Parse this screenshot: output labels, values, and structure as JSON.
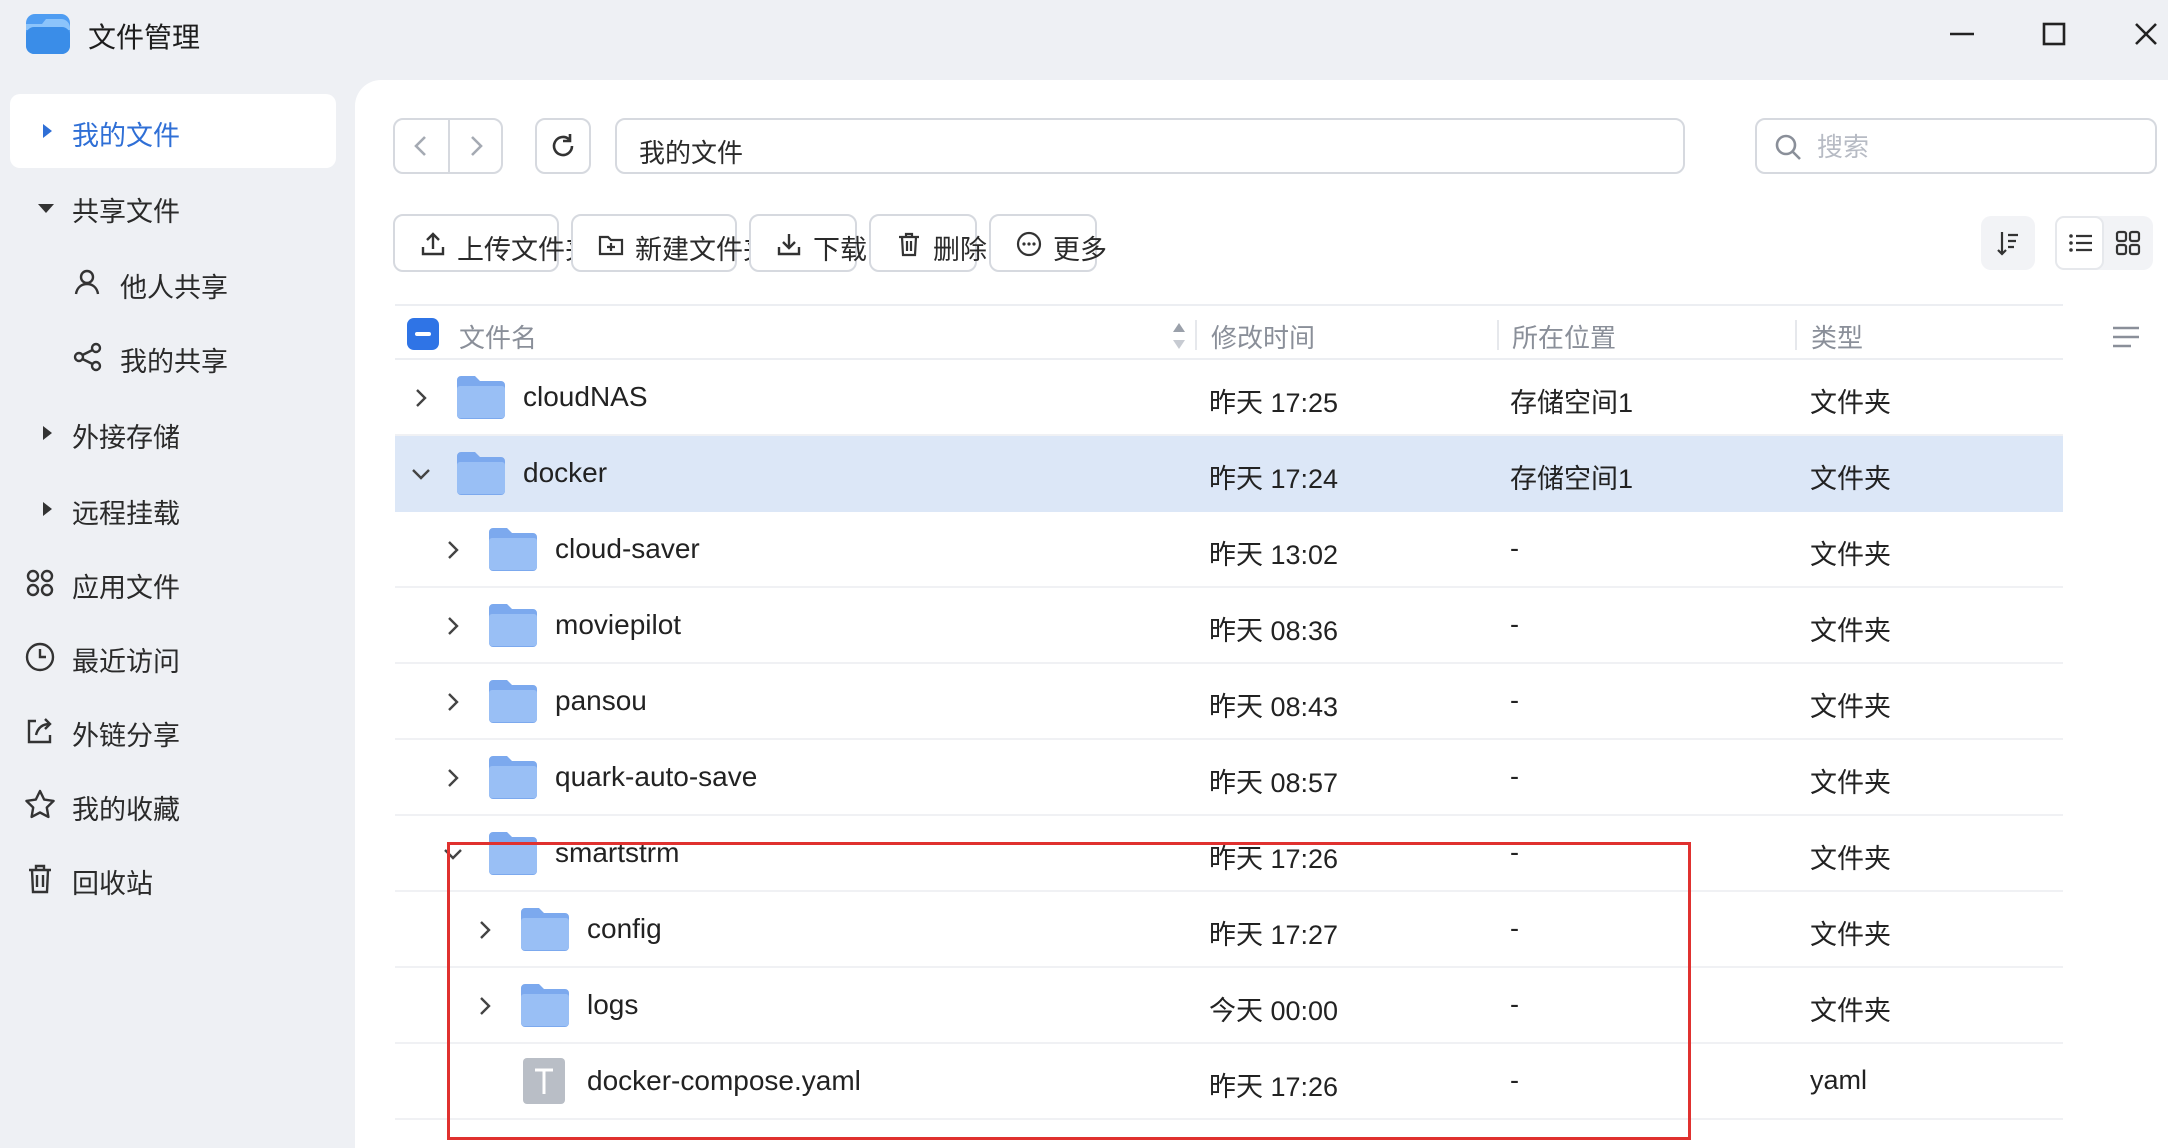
{
  "app": {
    "title": "文件管理",
    "accent": "#2f74e6",
    "highlight_color": "#e0312f"
  },
  "sidebar": {
    "items": [
      {
        "label": "我的文件",
        "icon": "caret-right-icon",
        "active": true
      },
      {
        "label": "共享文件",
        "icon": "caret-down-icon"
      },
      {
        "label": "他人共享",
        "icon": "user-icon"
      },
      {
        "label": "我的共享",
        "icon": "share-icon"
      },
      {
        "label": "外接存储",
        "icon": "caret-right-icon"
      },
      {
        "label": "远程挂载",
        "icon": "caret-right-icon"
      },
      {
        "label": "应用文件",
        "icon": "apps-icon"
      },
      {
        "label": "最近访问",
        "icon": "clock-icon"
      },
      {
        "label": "外链分享",
        "icon": "external-share-icon"
      },
      {
        "label": "我的收藏",
        "icon": "star-icon"
      },
      {
        "label": "回收站",
        "icon": "trash-icon"
      }
    ]
  },
  "toolbar": {
    "path": "我的文件",
    "search_placeholder": "搜索",
    "upload": "上传文件夹",
    "new_folder": "新建文件夹",
    "download": "下载",
    "delete": "删除",
    "more": "更多"
  },
  "table": {
    "headers": {
      "name": "文件名",
      "modified": "修改时间",
      "location": "所在位置",
      "type": "类型"
    },
    "rows": [
      {
        "name": "cloudNAS",
        "time": "昨天 17:25",
        "location": "存储空间1",
        "type": "文件夹",
        "depth": 0,
        "expanded": false
      },
      {
        "name": "docker",
        "time": "昨天 17:24",
        "location": "存储空间1",
        "type": "文件夹",
        "depth": 0,
        "expanded": true,
        "selected": true
      },
      {
        "name": "cloud-saver",
        "time": "昨天 13:02",
        "location": "-",
        "type": "文件夹",
        "depth": 1,
        "expanded": false
      },
      {
        "name": "moviepilot",
        "time": "昨天 08:36",
        "location": "-",
        "type": "文件夹",
        "depth": 1,
        "expanded": false
      },
      {
        "name": "pansou",
        "time": "昨天 08:43",
        "location": "-",
        "type": "文件夹",
        "depth": 1,
        "expanded": false
      },
      {
        "name": "quark-auto-save",
        "time": "昨天 08:57",
        "location": "-",
        "type": "文件夹",
        "depth": 1,
        "expanded": false
      },
      {
        "name": "smartstrm",
        "time": "昨天 17:26",
        "location": "-",
        "type": "文件夹",
        "depth": 1,
        "expanded": true
      },
      {
        "name": "config",
        "time": "昨天 17:27",
        "location": "-",
        "type": "文件夹",
        "depth": 2,
        "expanded": false
      },
      {
        "name": "logs",
        "time": "今天 00:00",
        "location": "-",
        "type": "文件夹",
        "depth": 2,
        "expanded": false
      },
      {
        "name": "docker-compose.yaml",
        "time": "昨天 17:26",
        "location": "-",
        "type": "yaml",
        "depth": 2,
        "file": true
      }
    ]
  }
}
